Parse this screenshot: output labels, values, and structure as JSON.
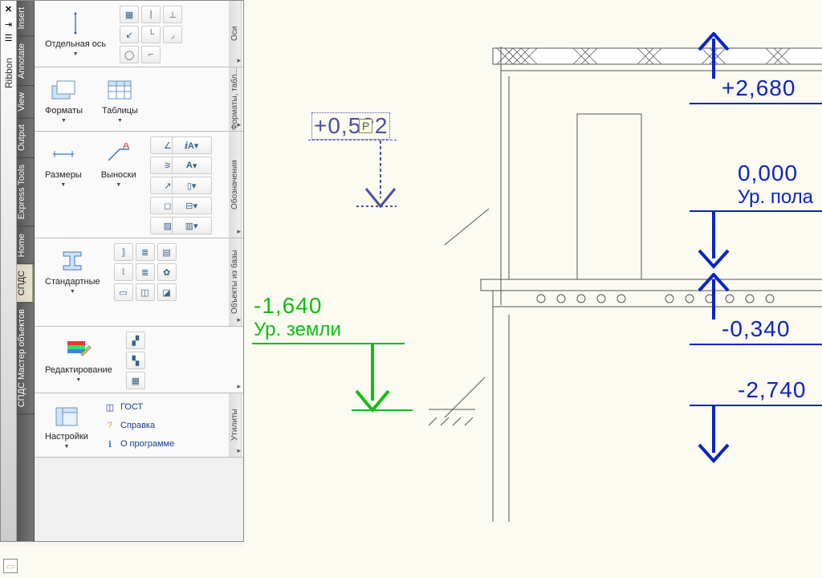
{
  "palette": {
    "title": "Ribbon",
    "tabs": [
      "Insert",
      "Annotate",
      "View",
      "Output",
      "Express Tools",
      "Home",
      "СПДС",
      "СПДС Мастер объектов"
    ],
    "active_tab": "СПДС",
    "panels": [
      {
        "title": "Оси",
        "buttons": [
          {
            "label": "Отдельная ось"
          }
        ]
      },
      {
        "title": "Форматы, табл...",
        "buttons": [
          {
            "label": "Форматы"
          },
          {
            "label": "Таблицы"
          }
        ]
      },
      {
        "title": "Обозначения",
        "buttons": [
          {
            "label": "Размеры"
          },
          {
            "label": "Выноски"
          }
        ]
      },
      {
        "title": "Объекты из базы",
        "buttons": [
          {
            "label": "Стандартные"
          }
        ]
      },
      {
        "title": "",
        "buttons": [
          {
            "label": "Редактирование"
          }
        ]
      },
      {
        "title": "Утилиты",
        "buttons": [
          {
            "label": "Настройки"
          }
        ],
        "links": [
          {
            "label": "ГОСТ"
          },
          {
            "label": "Справка"
          },
          {
            "label": "О программе"
          }
        ]
      }
    ]
  },
  "marks": {
    "editing": {
      "value": "+0,5?2",
      "cursor_hint": "P"
    },
    "ground": {
      "value": "-1,640",
      "label": "Ур. земли"
    },
    "top": {
      "value": "+2,680"
    },
    "zero": {
      "value": "0,000",
      "label": "Ур. пола"
    },
    "m034": {
      "value": "-0,340"
    },
    "m274": {
      "value": "-2,740"
    }
  }
}
